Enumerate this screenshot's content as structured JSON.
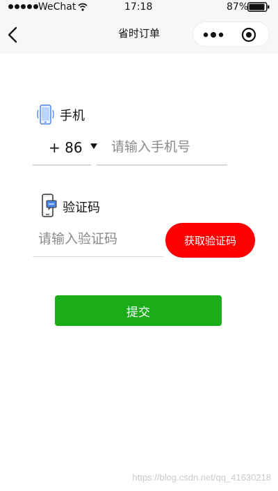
{
  "status_bar": {
    "carrier": "WeChat",
    "time": "17:18",
    "battery": "87%"
  },
  "nav": {
    "title": "省时订单",
    "icons": {
      "back": "chevron-left-icon",
      "more": "more-dots-icon",
      "close": "target-circle-icon"
    }
  },
  "form": {
    "phone_label": "手机",
    "country_code": "+ 86",
    "phone_placeholder": "请输入手机号",
    "code_label": "验证码",
    "code_placeholder": "请输入验证码",
    "get_code_label": "获取验证码",
    "submit_label": "提交"
  },
  "colors": {
    "nav_background": "#f7f7f7",
    "get_code_button": "#ff0000",
    "submit_button": "#1aad19"
  },
  "watermark": "https://blog.csdn.net/qq_41630218"
}
